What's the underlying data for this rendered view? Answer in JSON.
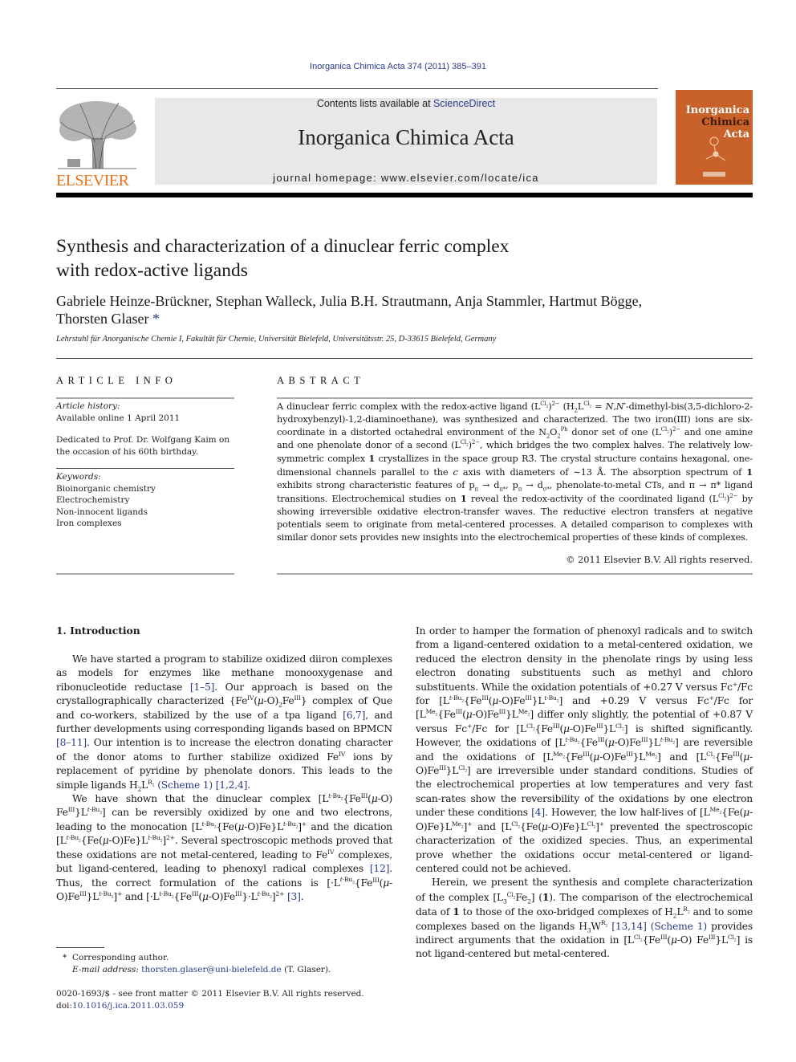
{
  "header": {
    "citation": "Inorganica Chimica Acta 374 (2011) 385–391",
    "contents_prefix": "Contents lists available at ",
    "contents_link": "ScienceDirect",
    "journal_title": "Inorganica Chimica Acta",
    "homepage": "journal homepage: www.elsevier.com/locate/ica",
    "publisher_logo_text": "ELSEVIER",
    "cover_title_line1": "Inorganica",
    "cover_title_line2a": "Chimica",
    "cover_title_line2b": "Acta",
    "colors": {
      "link": "#2a3a8a",
      "elsevier_orange": "#e8731c",
      "cover": "#c9622a",
      "banner": "#e8e8e8"
    }
  },
  "article": {
    "title_line1": "Synthesis and characterization of a dinuclear ferric complex",
    "title_line2": "with redox-active ligands",
    "authors_line1": "Gabriele Heinze-Brückner, Stephan Walleck, Julia B.H. Strautmann, Anja Stammler, Hartmut Bögge,",
    "authors_line2": "Thorsten Glaser",
    "corresponding_mark": "*",
    "affiliation": "Lehrstuhl für Anorganische Chemie I, Fakultät für Chemie, Universität Bielefeld, Universitätsstr. 25, D-33615 Bielefeld, Germany"
  },
  "article_info": {
    "heading": "ARTICLE INFO",
    "history_label": "Article history:",
    "history_value": "Available online 1 April 2011",
    "dedication": "Dedicated to Prof. Dr. Wolfgang Kaim on the occasion of his 60th birthday.",
    "keywords_label": "Keywords:",
    "keywords": [
      "Bioinorganic chemistry",
      "Electrochemistry",
      "Non-innocent ligands",
      "Iron complexes"
    ]
  },
  "abstract": {
    "heading": "ABSTRACT",
    "copyright": "© 2011 Elsevier B.V. All rights reserved."
  },
  "intro": {
    "heading": "1. Introduction"
  },
  "refs": {
    "r1_5": "[1–5]",
    "r6_7": "[6,7]",
    "r8": "[8–",
    "r11": "11]",
    "scheme1": "(Scheme 1)",
    "r124": "[1,2,4]",
    "r12": "[12]",
    "r3": "[3]",
    "r4": "[4]",
    "r13_14": "[13,14]"
  },
  "footer": {
    "corresponding": "Corresponding author.",
    "email_label": "E-mail address:",
    "email": "thorsten.glaser@uni-bielefeld.de",
    "email_suffix": " (T. Glaser).",
    "issn": "0020-1693/$ - see front matter © 2011 Elsevier B.V. All rights reserved.",
    "doi_prefix": "doi:",
    "doi": "10.1016/j.ica.2011.03.059"
  }
}
